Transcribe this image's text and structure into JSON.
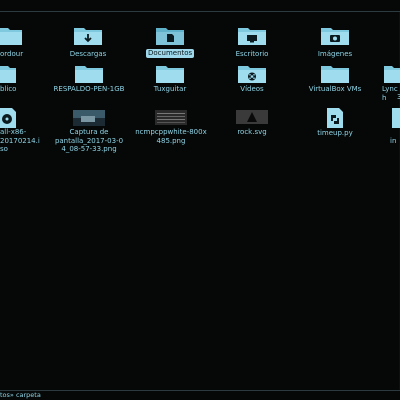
{
  "window": {
    "title": ""
  },
  "row1": [
    {
      "label": "ordour",
      "icon": "folder-icon"
    },
    {
      "label": "Descargas",
      "icon": "folder-download-icon"
    },
    {
      "label": "Documentos",
      "icon": "folder-documents-icon",
      "selected": true
    },
    {
      "label": "Escritorio",
      "icon": "folder-desktop-icon"
    },
    {
      "label": "Imágenes",
      "icon": "folder-pictures-icon"
    }
  ],
  "row2": [
    {
      "label": "blico",
      "icon": "folder-public-icon"
    },
    {
      "label": "RESPALDO-PEN-1GB",
      "icon": "folder-icon"
    },
    {
      "label": "Tuxguitar",
      "icon": "folder-icon"
    },
    {
      "label": "Vídeos",
      "icon": "folder-videos-icon"
    },
    {
      "label": "VirtualBox VMs",
      "icon": "folder-icon"
    },
    {
      "label": "Lynch",
      "icon": "folder-icon"
    }
  ],
  "row2_extra": "3",
  "row3": [
    {
      "label": "all-x86-\n20170214.i\nso",
      "icon": "disc-image-icon"
    },
    {
      "label": "Captura de\npantalla_2017-03-0\n4_08-57-33.png",
      "icon": "image-thumbnail-icon"
    },
    {
      "label": "ncmpcppwhite-800x\n485.png",
      "icon": "image-thumbnail-icon"
    },
    {
      "label": "rock.svg",
      "icon": "svg-thumbnail-icon"
    },
    {
      "label": "timeup.py",
      "icon": "python-script-icon"
    }
  ],
  "row3_extra": "in",
  "status": {
    "text": "tos» carpeta"
  },
  "colors": {
    "accent": "#8fd4e6",
    "background": "#050807",
    "selection": "#9fd8ea"
  }
}
